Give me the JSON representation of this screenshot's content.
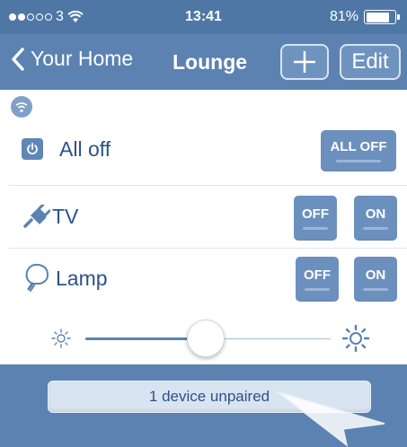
{
  "status_bar": {
    "carrier": "3",
    "time": "13:41",
    "battery": "81%",
    "battery_level": 0.81,
    "signal_bars": 2,
    "signal_total": 5
  },
  "nav": {
    "back_label": "Your Home",
    "title": "Lounge",
    "add_label": "+",
    "edit_label": "Edit"
  },
  "rows": {
    "all_off": {
      "label": "All off",
      "button": "ALL OFF"
    },
    "tv": {
      "label": "TV",
      "off": "OFF",
      "on": "ON"
    },
    "lamp": {
      "label": "Lamp",
      "off": "OFF",
      "on": "ON"
    }
  },
  "dimmer": {
    "level": 0.5
  },
  "footer": {
    "unpaired": "1 device unpaired"
  },
  "colors": {
    "primary": "#5b82b0",
    "status_bar": "#4f77a6",
    "button": "#6c90bd",
    "text": "#2d5288"
  },
  "icons": {
    "wifi": "wifi-icon",
    "power": "power-icon",
    "plug": "plug-icon",
    "lamp": "lamp-icon",
    "sun_small": "brightness-low-icon",
    "sun_large": "brightness-high-icon",
    "back": "chevron-left-icon"
  }
}
